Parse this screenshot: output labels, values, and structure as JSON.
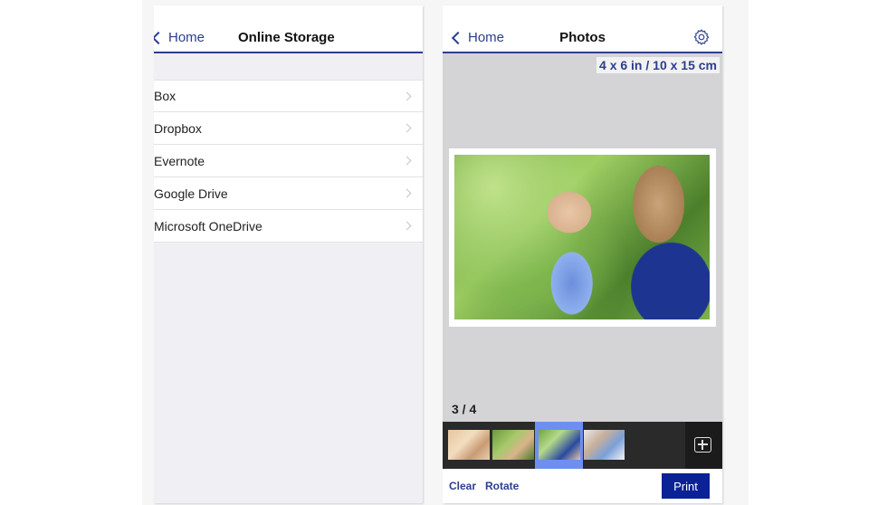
{
  "left_screen": {
    "nav": {
      "back_label": "Home",
      "title": "Online Storage"
    },
    "services": [
      {
        "label": "Box"
      },
      {
        "label": "Dropbox"
      },
      {
        "label": "Evernote"
      },
      {
        "label": "Google Drive"
      },
      {
        "label": "Microsoft OneDrive"
      }
    ]
  },
  "right_screen": {
    "nav": {
      "back_label": "Home",
      "title": "Photos",
      "settings_icon": "gear-icon"
    },
    "paper_size": "4 x 6 in / 10 x 15 cm",
    "photo_counter": "3 / 4",
    "thumbnails": [
      {
        "name": "photo-1",
        "selected": false
      },
      {
        "name": "photo-2",
        "selected": false
      },
      {
        "name": "photo-3",
        "selected": true
      },
      {
        "name": "photo-4",
        "selected": false
      }
    ],
    "add_icon": "plus-square-icon",
    "toolbar": {
      "clear_label": "Clear",
      "rotate_label": "Rotate",
      "print_label": "Print"
    }
  },
  "colors": {
    "accent_blue": "#2c3e8c",
    "print_button": "#0a2295",
    "selected_thumb": "#6e8ff0",
    "filmstrip_bg": "#2a2a2a"
  }
}
